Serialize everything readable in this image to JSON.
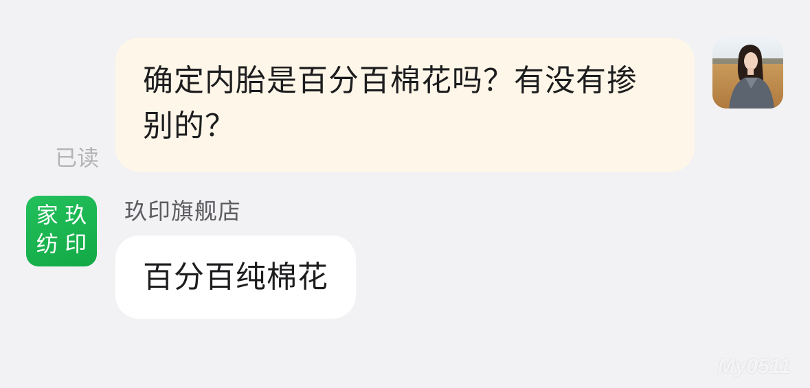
{
  "messages": {
    "outgoing": {
      "text": "确定内胎是百分百棉花吗？有没有掺别的？",
      "status": "已读",
      "avatar": "user-photo-avatar"
    },
    "incoming": {
      "sender_name": "玖印旗舰店",
      "avatar_chars": [
        "家",
        "玖",
        "纺",
        "印"
      ],
      "avatar_color": "#1db954",
      "text": "百分百纯棉花"
    }
  },
  "colors": {
    "background": "#f2f2f4",
    "outgoing_bubble": "#fef6e8",
    "incoming_bubble": "#ffffff"
  },
  "watermark": "My0511"
}
